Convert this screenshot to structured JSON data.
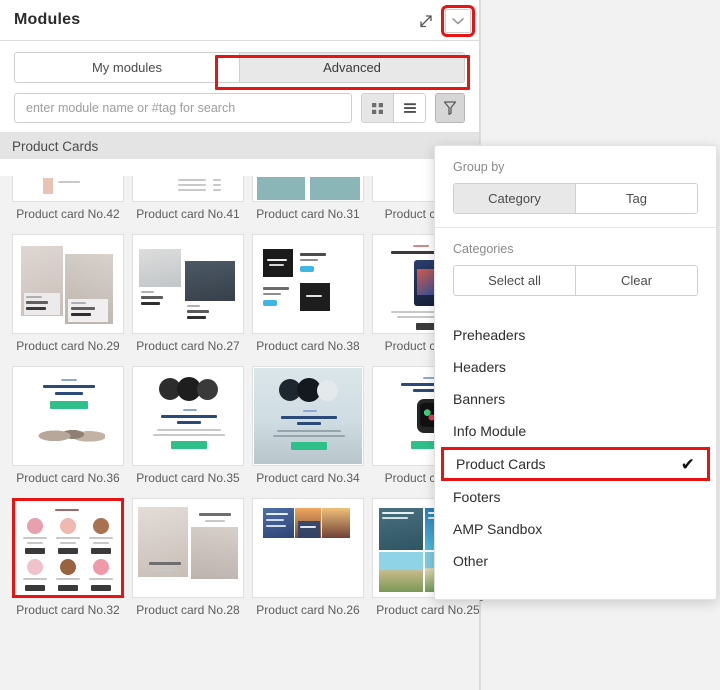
{
  "header": {
    "title": "Modules",
    "expand_icon": "expand-diagonal-icon",
    "collapse_icon": "chevron-down-icon"
  },
  "tabs": [
    {
      "label": "My modules",
      "active": false
    },
    {
      "label": "Advanced",
      "active": true,
      "highlighted": true
    }
  ],
  "search": {
    "placeholder": "enter module name or #tag for search",
    "value": ""
  },
  "view_toggle": [
    {
      "icon": "grid-view-icon",
      "active": true
    },
    {
      "icon": "list-view-icon",
      "active": false
    }
  ],
  "filter_button": {
    "icon": "funnel-filter-icon",
    "active": true
  },
  "section": {
    "title": "Product Cards"
  },
  "grid": {
    "rows": [
      {
        "clipped": true,
        "cards": [
          {
            "label": "Product card No.42"
          },
          {
            "label": "Product card No.41"
          },
          {
            "label": "Product card No.31"
          },
          {
            "label": "Product card No"
          }
        ]
      },
      {
        "clipped": false,
        "cards": [
          {
            "label": "Product card No.29"
          },
          {
            "label": "Product card No.27"
          },
          {
            "label": "Product card No.38"
          },
          {
            "label": "Product card No"
          }
        ]
      },
      {
        "clipped": false,
        "cards": [
          {
            "label": "Product card No.36"
          },
          {
            "label": "Product card No.35"
          },
          {
            "label": "Product card No.34"
          },
          {
            "label": "Product card No"
          }
        ]
      },
      {
        "clipped": false,
        "cards": [
          {
            "label": "Product card No.32",
            "selected": true
          },
          {
            "label": "Product card No.28"
          },
          {
            "label": "Product card No.26"
          },
          {
            "label": "Product card No.25"
          }
        ]
      }
    ]
  },
  "dropdown": {
    "group_by_label": "Group by",
    "group_by_options": [
      {
        "label": "Category",
        "active": true
      },
      {
        "label": "Tag",
        "active": false
      }
    ],
    "categories_label": "Categories",
    "category_actions": [
      {
        "label": "Select all"
      },
      {
        "label": "Clear"
      }
    ],
    "categories": [
      {
        "label": "Preheaders",
        "checked": false,
        "highlighted": false
      },
      {
        "label": "Headers",
        "checked": false,
        "highlighted": false
      },
      {
        "label": "Banners",
        "checked": false,
        "highlighted": false
      },
      {
        "label": "Info Module",
        "checked": false,
        "highlighted": false
      },
      {
        "label": "Product Cards",
        "checked": true,
        "highlighted": true,
        "check_glyph": "✔"
      },
      {
        "label": "Footers",
        "checked": false,
        "highlighted": false
      },
      {
        "label": "AMP Sandbox",
        "checked": false,
        "highlighted": false
      },
      {
        "label": "Other",
        "checked": false,
        "highlighted": false
      }
    ]
  },
  "colors": {
    "highlight_red": "#e81313",
    "panel_bg": "#ffffff",
    "grid_bg": "#f2f2f2",
    "section_bar": "#e4e4e4"
  }
}
